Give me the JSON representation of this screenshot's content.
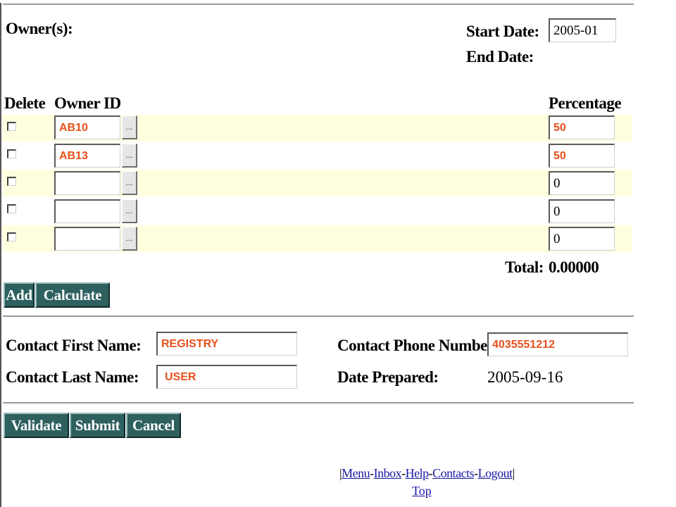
{
  "owners_section": {
    "title": "Owner(s):",
    "start_date_label": "Start Date:",
    "start_date_value": "2005-01",
    "end_date_label": "End Date:"
  },
  "table": {
    "headers": {
      "delete": "Delete",
      "owner_id": "Owner ID",
      "percentage": "Percentage"
    },
    "lookup_label": "...",
    "rows": [
      {
        "owner_id": "AB10",
        "percentage": "50"
      },
      {
        "owner_id": "AB13",
        "percentage": "50"
      },
      {
        "owner_id": "",
        "percentage": "0"
      },
      {
        "owner_id": "",
        "percentage": "0"
      },
      {
        "owner_id": "",
        "percentage": "0"
      }
    ],
    "total_label": "Total:",
    "total_value": "0.00000"
  },
  "actions": {
    "add": "Add",
    "calculate": "Calculate"
  },
  "contact": {
    "first_name_label": "Contact First Name:",
    "first_name_value": "REGISTRY",
    "last_name_label": "Contact Last Name:",
    "last_name_value": "USER",
    "phone_label": "Contact Phone Number:",
    "phone_value": "4035551212",
    "date_prepared_label": "Date Prepared:",
    "date_prepared_value": "2005-09-16"
  },
  "form_buttons": {
    "validate": "Validate",
    "submit": "Submit",
    "cancel": "Cancel"
  },
  "footer": {
    "menu": "Menu",
    "inbox": "Inbox",
    "help": "Help",
    "contacts": "Contacts",
    "logout": "Logout",
    "separator": "-",
    "left_bracket": "|",
    "right_bracket": "|",
    "top": "Top"
  },
  "colors": {
    "row_highlight": "#ffffe0",
    "button_bg": "#2f6060",
    "entered_text": "#e8501c",
    "link": "#1a1aa6"
  }
}
